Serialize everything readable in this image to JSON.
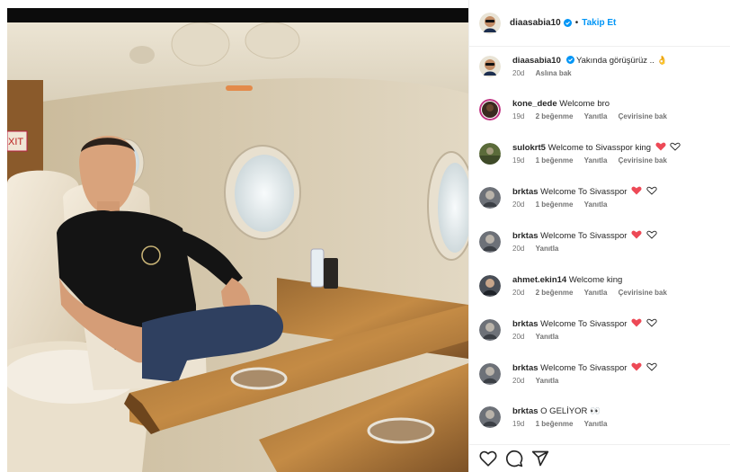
{
  "post": {
    "username": "diaasabia10",
    "follow_label": "Takip Et",
    "separator": "•",
    "image_alt": "Man in black t-shirt seated in a private jet cabin"
  },
  "caption": {
    "username": "diaasabia10",
    "text": "Yakında görüşürüz .. 👌",
    "age": "20d",
    "translate": "Aslına bak"
  },
  "comments": [
    {
      "username": "kone_dede",
      "text": "Welcome bro",
      "age": "19d",
      "likes": "2 beğenme",
      "reply": "Yanıtla",
      "translate": "Çevirisine bak",
      "heart": false
    },
    {
      "username": "sulokrt5",
      "text": "Welcome to Sivasspor king",
      "age": "19d",
      "likes": "1 beğenme",
      "reply": "Yanıtla",
      "translate": "Çevirisine bak",
      "heart": true
    },
    {
      "username": "brktas",
      "text": "Welcome To Sivasspor",
      "age": "20d",
      "likes": "1 beğenme",
      "reply": "Yanıtla",
      "translate": "",
      "heart": true
    },
    {
      "username": "brktas",
      "text": "Welcome To Sivasspor",
      "age": "20d",
      "likes": "",
      "reply": "Yanıtla",
      "translate": "",
      "heart": true
    },
    {
      "username": "ahmet.ekin14",
      "text": "Welcome king",
      "age": "20d",
      "likes": "2 beğenme",
      "reply": "Yanıtla",
      "translate": "Çevirisine bak",
      "heart": false
    },
    {
      "username": "brktas",
      "text": "Welcome To Sivasspor",
      "age": "20d",
      "likes": "",
      "reply": "Yanıtla",
      "translate": "",
      "heart": true
    },
    {
      "username": "brktas",
      "text": "Welcome To Sivasspor",
      "age": "20d",
      "likes": "",
      "reply": "Yanıtla",
      "translate": "",
      "heart": true
    },
    {
      "username": "brktas",
      "text": "O GELİYOR 👀",
      "age": "19d",
      "likes": "1 beğenme",
      "reply": "Yanıtla",
      "translate": "",
      "heart": false
    }
  ],
  "actions": {
    "icons": [
      "heart-outline-icon",
      "comment-icon",
      "share-icon"
    ]
  },
  "colors": {
    "link": "#0095f6",
    "verified": "#0095f6",
    "heart_red": "#ed4956",
    "meta_gray": "#737373"
  }
}
